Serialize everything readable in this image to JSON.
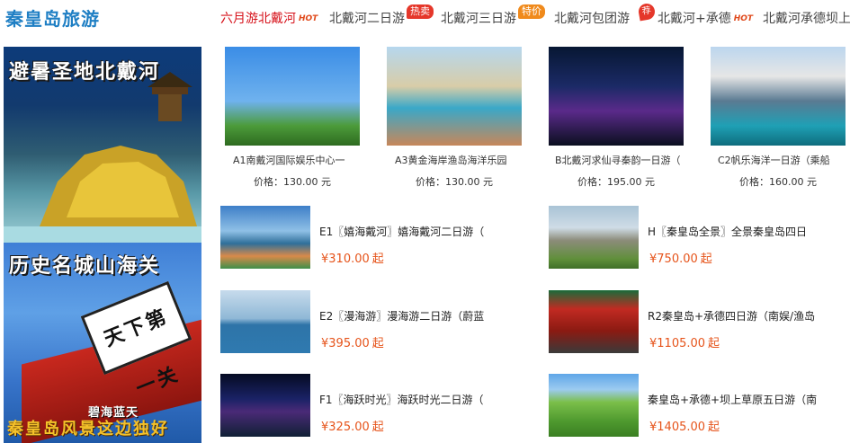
{
  "logo": "秦皇岛旅游",
  "nav": {
    "items": [
      {
        "label": "六月游北戴河",
        "hot": "HOT"
      },
      {
        "label": "北戴河二日游",
        "badge": "热卖"
      },
      {
        "label": "北戴河三日游",
        "badge": "特价"
      },
      {
        "label": "北戴河包团游",
        "badge": "荐"
      },
      {
        "label": "北戴河+承德",
        "hot": "HOT"
      },
      {
        "label": "北戴河承德坝上"
      }
    ]
  },
  "banners": {
    "top": {
      "title": "避暑圣地北戴河"
    },
    "bottom": {
      "title": "历史名城山海关",
      "sign": "天下第一关",
      "caption": "碧海蓝天",
      "slogan": "秦皇岛风景这边独好"
    }
  },
  "featured": [
    {
      "title": "A1南戴河国际娱乐中心一",
      "price": "价格：130.00 元"
    },
    {
      "title": "A3黄金海岸渔岛海洋乐园",
      "price": "价格：130.00 元"
    },
    {
      "title": "B北戴河求仙寻秦韵一日游（",
      "price": "价格：195.00 元"
    },
    {
      "title": "C2帆乐海洋一日游（乘船",
      "price": "价格：160.00 元"
    }
  ],
  "tours": [
    {
      "title": "E1〖嬉海戴河〗嬉海戴河二日游（",
      "price": "¥310.00",
      "unit": "起"
    },
    {
      "title": "E2〖漫海游〗漫海游二日游（蔚蓝",
      "price": "¥395.00",
      "unit": "起"
    },
    {
      "title": "F1〖海跃时光〗海跃时光二日游（",
      "price": "¥325.00",
      "unit": "起"
    },
    {
      "title": "H〖秦皇岛全景〗全景秦皇岛四日",
      "price": "¥750.00",
      "unit": "起"
    },
    {
      "title": "R2秦皇岛+承德四日游（南娱/渔岛",
      "price": "¥1105.00",
      "unit": "起"
    },
    {
      "title": "秦皇岛+承德+坝上草原五日游（南",
      "price": "¥1405.00",
      "unit": "起"
    }
  ]
}
